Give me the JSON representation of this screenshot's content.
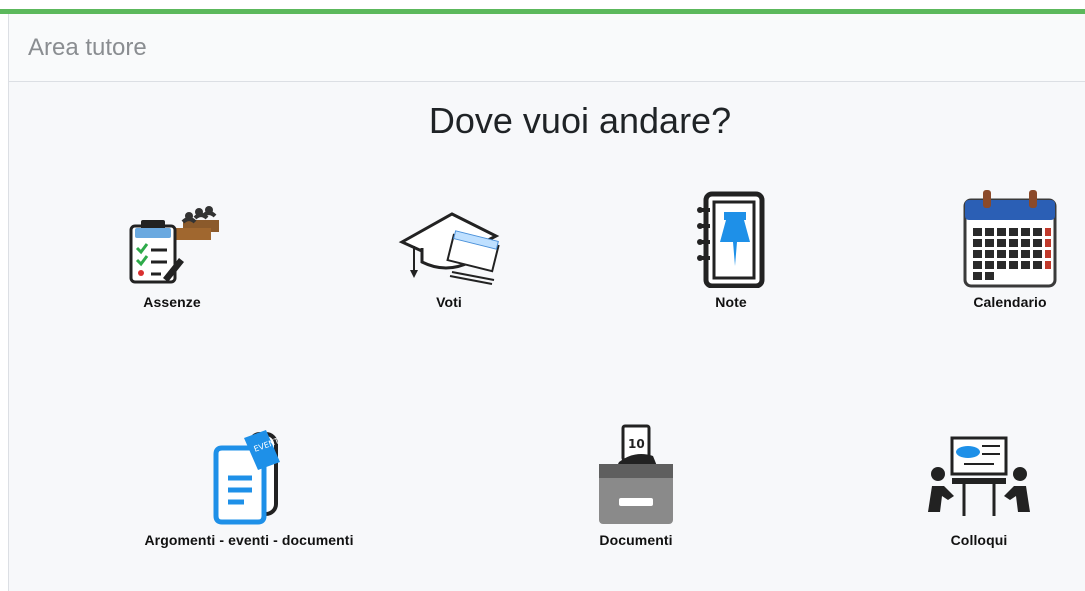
{
  "header": {
    "title": "Area tutore"
  },
  "main": {
    "question": "Dove vuoi andare?",
    "tiles": [
      {
        "label": "Assenze",
        "icon": "attendance-clipboard-icon"
      },
      {
        "label": "Voti",
        "icon": "graduation-cap-icon"
      },
      {
        "label": "Note",
        "icon": "notebook-pin-icon"
      },
      {
        "label": "Calendario",
        "icon": "calendar-icon"
      },
      {
        "label": "Argomenti - eventi - documenti",
        "icon": "document-event-icon"
      },
      {
        "label": "Documenti",
        "icon": "document-tray-icon"
      },
      {
        "label": "Colloqui",
        "icon": "meeting-board-icon"
      }
    ]
  },
  "colors": {
    "accent": "#5cb85c",
    "blue": "#1e90e8",
    "dark": "#222222",
    "calendar_red": "#c0392b"
  }
}
